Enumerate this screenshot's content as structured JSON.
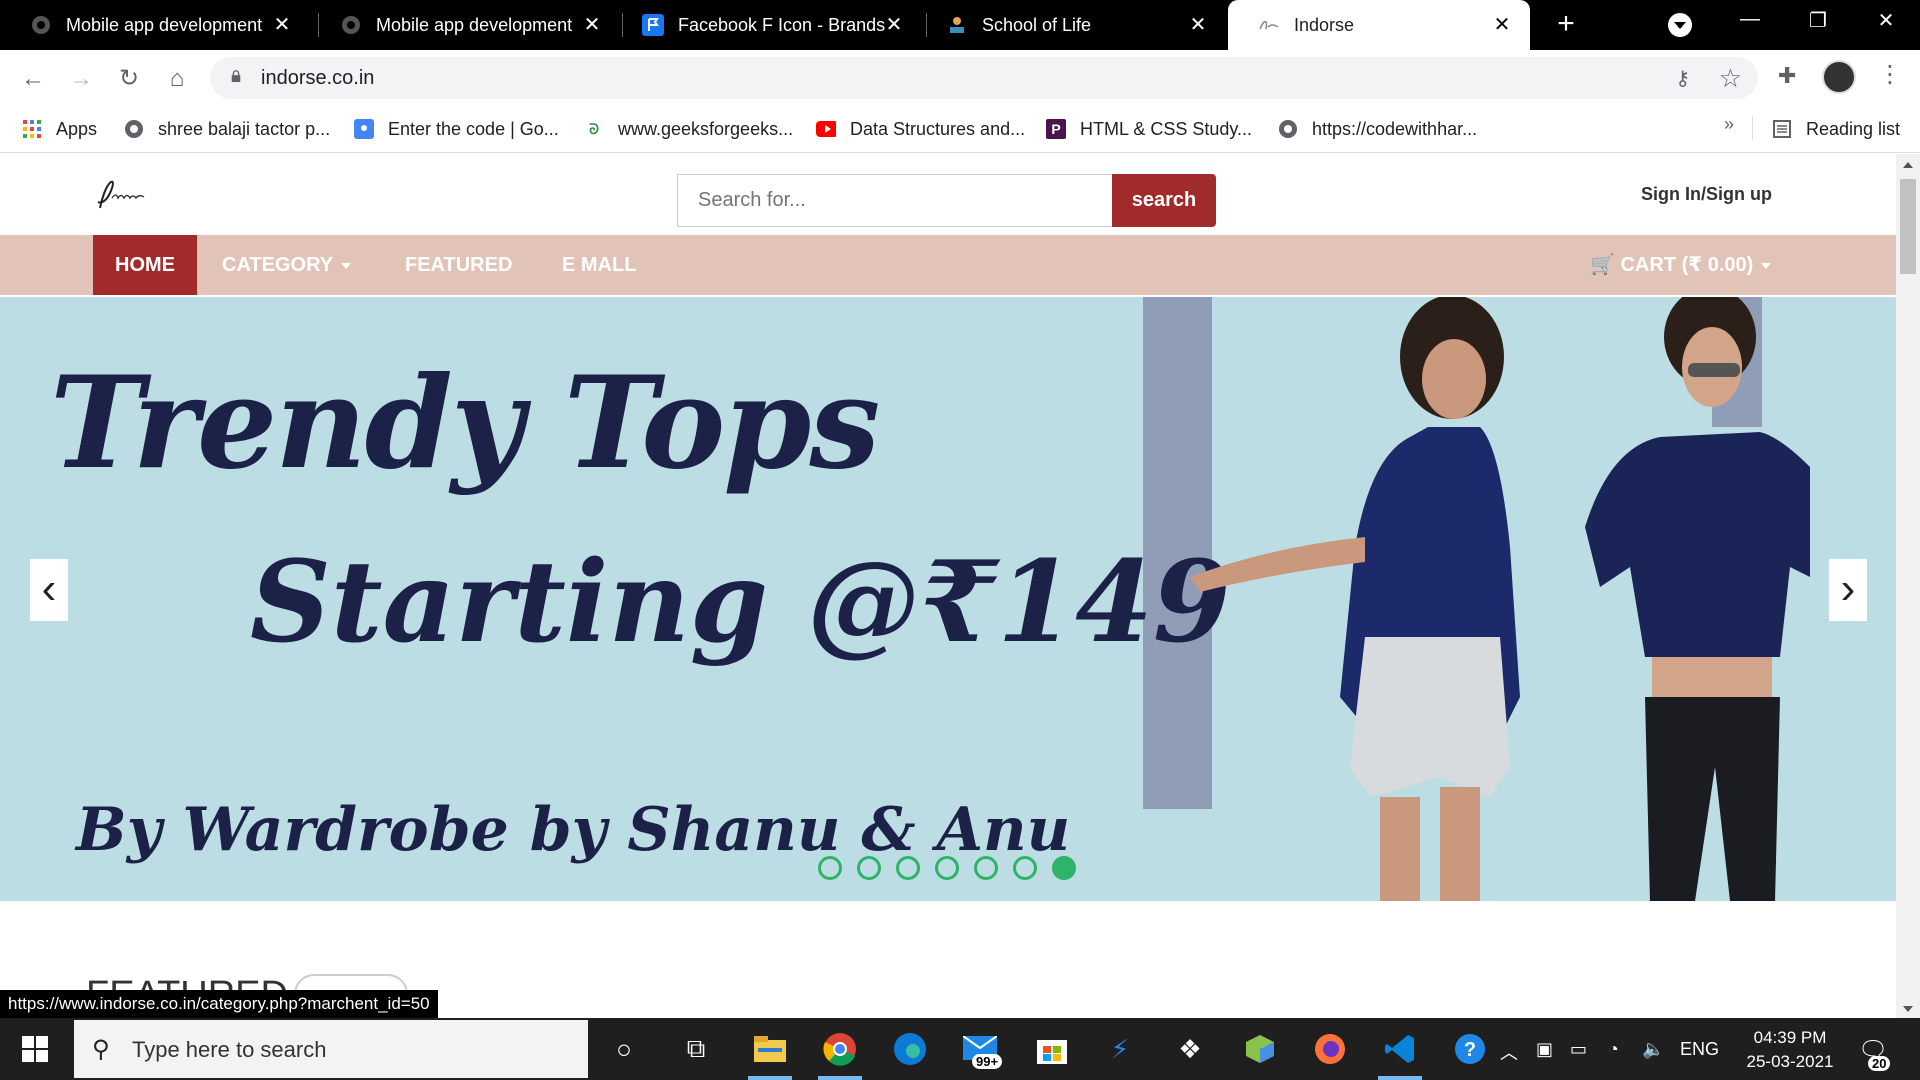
{
  "tabs": [
    {
      "title": "Mobile app development",
      "active": false
    },
    {
      "title": "Mobile app development",
      "active": false
    },
    {
      "title": "Facebook F Icon - Brands",
      "active": false
    },
    {
      "title": "School of Life",
      "active": false
    },
    {
      "title": "Indorse",
      "active": true
    }
  ],
  "address_bar": {
    "url": "indorse.co.in"
  },
  "bookmarks": [
    {
      "label": "Apps",
      "icon": "apps-grid-icon"
    },
    {
      "label": "shree balaji tactor p...",
      "icon": "globe-icon"
    },
    {
      "label": "Enter the code | Go...",
      "icon": "google-classroom-icon"
    },
    {
      "label": "www.geeksforgeeks...",
      "icon": "geeksforgeeks-icon"
    },
    {
      "label": "Data Structures and...",
      "icon": "youtube-icon"
    },
    {
      "label": "HTML & CSS Study...",
      "icon": "p-icon"
    },
    {
      "label": "https://codewithhar...",
      "icon": "globe-icon"
    }
  ],
  "reading_list": "Reading list",
  "site": {
    "search_placeholder": "Search for...",
    "search_button": "search",
    "signin": "Sign In/Sign up",
    "nav": {
      "home": "HOME",
      "category": "CATEGORY",
      "featured": "FEATURED",
      "emall": "E MALL"
    },
    "cart": "CART (₹ 0.00)",
    "banner": {
      "title": "Trendy Tops",
      "price": "Starting @₹149",
      "by": "By Wardrobe by Shanu & Anu",
      "slides": 7,
      "active_slide": 7
    },
    "featured_heading": "FEATURED"
  },
  "status_url": "https://www.indorse.co.in/category.php?marchent_id=50",
  "taskbar": {
    "search_placeholder": "Type here to search",
    "mail_badge": "99+",
    "language": "ENG",
    "time": "04:39 PM",
    "date": "25-03-2021",
    "notifications": "20"
  },
  "colors": {
    "brand_red": "#a12a2a",
    "nav_bg": "#e2c3b8",
    "banner_bg": "#bcdde3",
    "banner_text": "#1c2147",
    "carousel_dot": "#2fb36a"
  }
}
